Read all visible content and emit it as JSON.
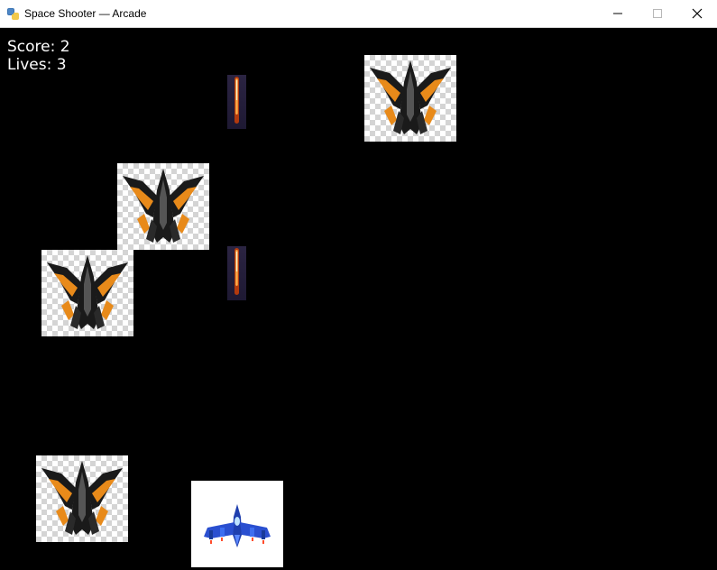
{
  "window": {
    "title": "Space Shooter — Arcade",
    "icons": [
      "python-app-icon",
      "minimize-icon",
      "maximize-icon",
      "close-icon"
    ]
  },
  "hud": {
    "score_text": "Score: 2",
    "lives_text": "Lives: 3"
  },
  "game": {
    "enemies": [
      {
        "kind": "enemy-ship"
      },
      {
        "kind": "enemy-ship"
      },
      {
        "kind": "enemy-ship"
      },
      {
        "kind": "enemy-ship"
      }
    ],
    "bullets": [
      {
        "kind": "laser"
      },
      {
        "kind": "laser"
      }
    ],
    "player": {
      "kind": "player-ship"
    },
    "colors": {
      "background": "#000000",
      "enemy_accent": "#e88a1a",
      "enemy_body": "#1a1a1a",
      "player_body": "#2a4fd0",
      "laser_core": "#ff7a1a"
    }
  }
}
